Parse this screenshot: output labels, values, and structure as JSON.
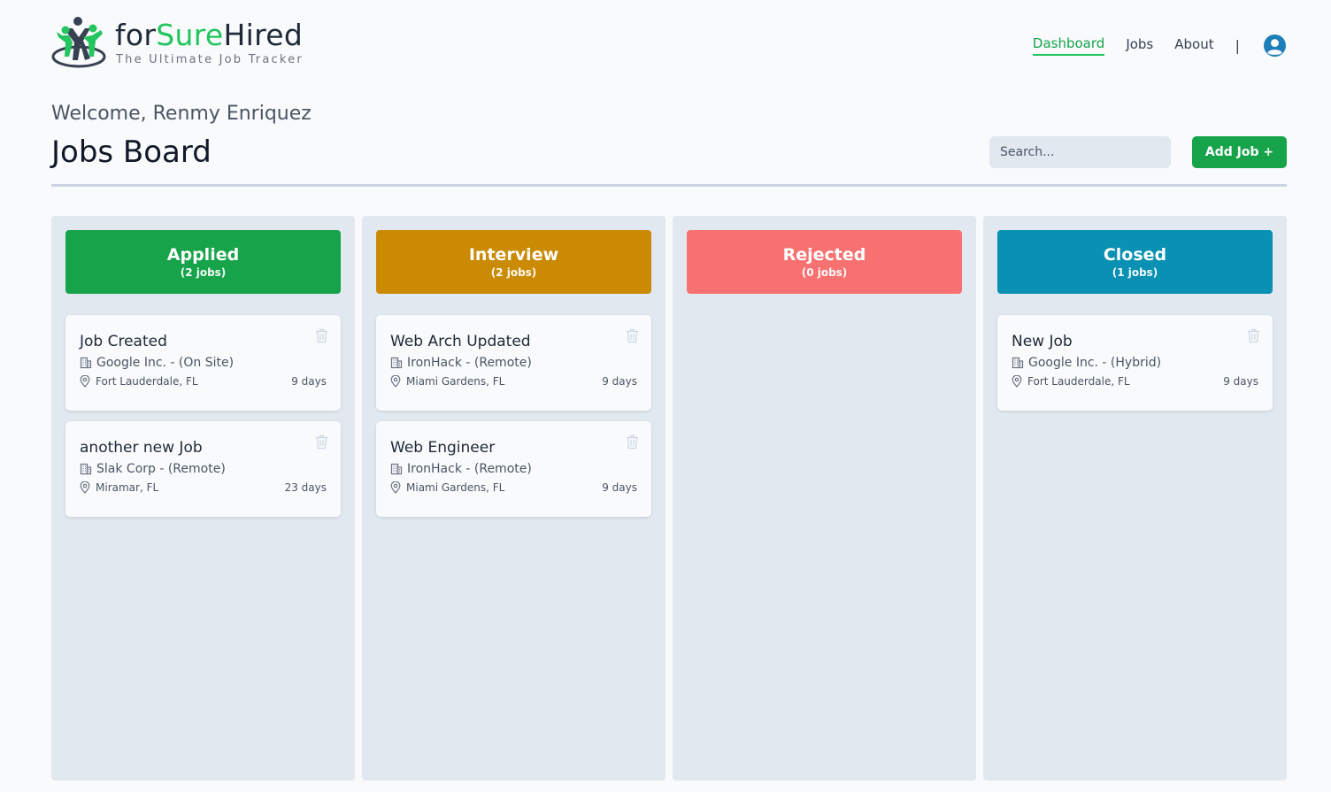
{
  "brand": {
    "name_prefix": "for",
    "name_highlight": "Sure",
    "name_suffix": "Hired",
    "tagline": "The Ultimate Job Tracker"
  },
  "nav": {
    "items": [
      {
        "label": "Dashboard",
        "active": true
      },
      {
        "label": "Jobs"
      },
      {
        "label": "About"
      }
    ],
    "separator": "|"
  },
  "welcome": "Welcome, Renmy Enriquez",
  "board_title": "Jobs Board",
  "search": {
    "placeholder": "Search..."
  },
  "add_job_label": "Add Job +",
  "columns": [
    {
      "title": "Applied",
      "count_label": "(2 jobs)",
      "color": "#16a34a",
      "jobs": [
        {
          "title": "Job Created",
          "company": "Google Inc. - (On Site)",
          "location": "Fort Lauderdale, FL",
          "age": "9 days"
        },
        {
          "title": "another new Job",
          "company": "Slak Corp - (Remote)",
          "location": "Miramar, FL",
          "age": "23 days"
        }
      ]
    },
    {
      "title": "Interview",
      "count_label": "(2 jobs)",
      "color": "#ca8a04",
      "jobs": [
        {
          "title": "Web Arch Updated",
          "company": "IronHack - (Remote)",
          "location": "Miami Gardens, FL",
          "age": "9 days"
        },
        {
          "title": "Web Engineer",
          "company": "IronHack - (Remote)",
          "location": "Miami Gardens, FL",
          "age": "9 days"
        }
      ]
    },
    {
      "title": "Rejected",
      "count_label": "(0 jobs)",
      "color": "#f87171",
      "jobs": []
    },
    {
      "title": "Closed",
      "count_label": "(1 jobs)",
      "color": "#0891b2",
      "jobs": [
        {
          "title": "New Job",
          "company": "Google Inc. - (Hybrid)",
          "location": "Fort Lauderdale, FL",
          "age": "9 days"
        }
      ]
    }
  ],
  "colors": {
    "accent": "#16a34a",
    "column_bg": "#e2e8f0",
    "avatar": "#1e7fb8"
  },
  "icons": {
    "company": "building-icon",
    "location": "map-pin-icon",
    "delete": "trash-icon",
    "user": "user-avatar-icon"
  }
}
